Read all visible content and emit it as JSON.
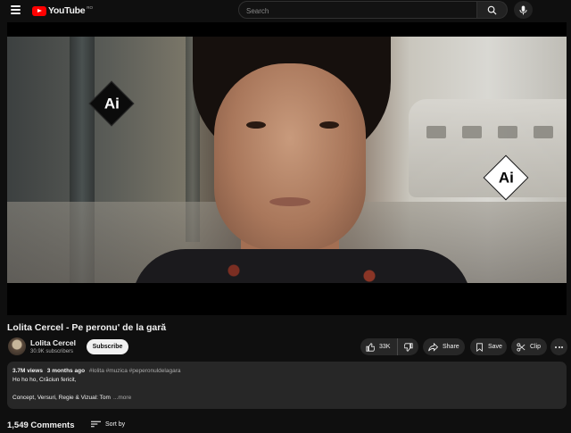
{
  "header": {
    "logo_text": "YouTube",
    "logo_region": "RO",
    "search_placeholder": "Search",
    "brand_color": "#ff0000"
  },
  "video": {
    "watermark_text": "Ai"
  },
  "title": "Lolita Cercel - Pe peronu' de la gară",
  "channel": {
    "name": "Lolita Cercel",
    "subscribers": "30.9K subscribers",
    "subscribe_label": "Subscribe"
  },
  "actions": {
    "like_count": "33K",
    "share_label": "Share",
    "save_label": "Save",
    "clip_label": "Clip"
  },
  "description": {
    "views": "3.7M views",
    "age": "3 months ago",
    "hashtags": "#lolita #muzica #peperonuldelagara",
    "line1": "Ho ho ho, Crăciun fericit,",
    "line2": "Concept, Versuri, Regie & Vizual: Tom",
    "more_label": "...more"
  },
  "comments": {
    "count_label": "1,549 Comments",
    "sort_label": "Sort by"
  },
  "icons": {
    "menu": "hamburger-icon",
    "search": "search-icon",
    "mic": "microphone-icon",
    "like": "thumbs-up-icon",
    "dislike": "thumbs-down-icon",
    "share": "share-arrow-icon",
    "save": "bookmark-icon",
    "clip": "scissors-icon",
    "more": "more-horizontal-icon",
    "sort": "sort-icon"
  }
}
